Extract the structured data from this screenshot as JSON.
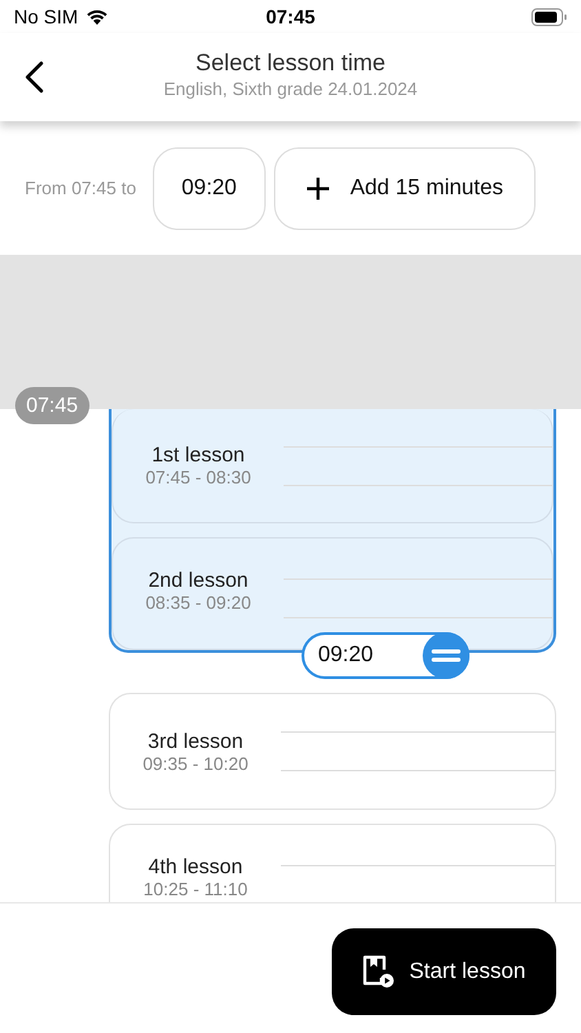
{
  "status_bar": {
    "carrier": "No SIM",
    "time": "07:45"
  },
  "header": {
    "title": "Select lesson time",
    "subtitle": "English, Sixth grade 24.01.2024"
  },
  "time_range": {
    "label": "From 07:45 to",
    "end_time": "09:20",
    "add_button": "Add 15 minutes"
  },
  "timeline": {
    "start_marker": "07:45",
    "end_handle": "09:20",
    "lessons": [
      {
        "name": "1st lesson",
        "time": "07:45 - 08:30",
        "selected": true
      },
      {
        "name": "2nd lesson",
        "time": "08:35 - 09:20",
        "selected": true
      },
      {
        "name": "3rd lesson",
        "time": "09:35 - 10:20",
        "selected": false
      },
      {
        "name": "4th lesson",
        "time": "10:25 - 11:10",
        "selected": false
      }
    ]
  },
  "start_button": "Start lesson"
}
